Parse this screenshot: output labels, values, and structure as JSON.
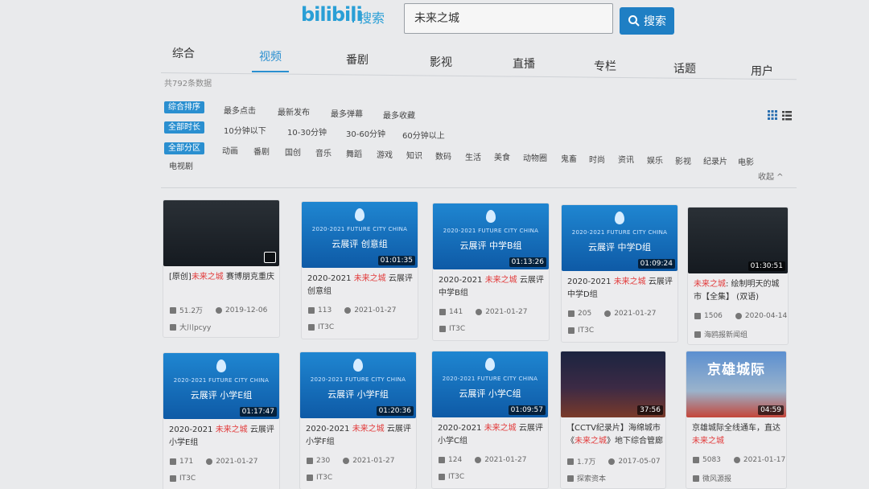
{
  "header": {
    "logo": "bilibili",
    "logo_sub": "搜索",
    "search_value": "未来之城",
    "search_button": "搜索"
  },
  "tabs": [
    "综合",
    "视频",
    "番剧",
    "影视",
    "直播",
    "专栏",
    "话题",
    "用户"
  ],
  "result_count": "共792条数据",
  "filters": {
    "sort": {
      "chip": "综合排序",
      "options": [
        "最多点击",
        "最新发布",
        "最多弹幕",
        "最多收藏"
      ]
    },
    "duration": {
      "chip": "全部时长",
      "options": [
        "10分钟以下",
        "10-30分钟",
        "30-60分钟",
        "60分钟以上"
      ]
    },
    "zone": {
      "chip": "全部分区",
      "options": [
        "动画",
        "番剧",
        "国创",
        "音乐",
        "舞蹈",
        "游戏",
        "知识",
        "数码",
        "生活",
        "美食",
        "动物圈",
        "鬼畜",
        "时尚",
        "资讯",
        "娱乐",
        "影视",
        "纪录片",
        "电影",
        "电视剧"
      ]
    },
    "collapse": "收起 ^"
  },
  "videos": [
    {
      "thumb_dur": "",
      "brand": "",
      "sub": "",
      "title_pre": "[原创]",
      "title_hl": "未来之城",
      "title_post": " 赛博朋克重庆",
      "views": "51.2万",
      "date": "2019-12-06",
      "uploader": "大川pcyy"
    },
    {
      "thumb_dur": "01:01:35",
      "brand": "2020-2021 FUTURE CITY CHINA",
      "sub": "云展评  创意组",
      "title_pre": "2020-2021 ",
      "title_hl": "未来之城",
      "title_post": " 云展评 创意组",
      "views": "113",
      "date": "2021-01-27",
      "uploader": "IT3C"
    },
    {
      "thumb_dur": "01:13:26",
      "brand": "2020-2021 FUTURE CITY CHINA",
      "sub": "云展评  中学B组",
      "title_pre": "2020-2021 ",
      "title_hl": "未来之城",
      "title_post": " 云展评 中学B组",
      "views": "141",
      "date": "2021-01-27",
      "uploader": "IT3C"
    },
    {
      "thumb_dur": "01:09:24",
      "brand": "2020-2021 FUTURE CITY CHINA",
      "sub": "云展评  中学D组",
      "title_pre": "2020-2021 ",
      "title_hl": "未来之城",
      "title_post": " 云展评 中学D组",
      "views": "205",
      "date": "2021-01-27",
      "uploader": "IT3C"
    },
    {
      "thumb_dur": "01:30:51",
      "brand": "",
      "sub": "",
      "title_pre": "",
      "title_hl": "未来之城",
      "title_post": ": 绘制明天的城市【全集】 (双语)",
      "views": "1506",
      "date": "2020-04-14",
      "uploader": "海鸥报新闻组"
    },
    {
      "thumb_dur": "01:17:47",
      "brand": "2020-2021 FUTURE CITY CHINA",
      "sub": "云展评  小学E组",
      "title_pre": "2020-2021 ",
      "title_hl": "未来之城",
      "title_post": " 云展评 小学E组",
      "views": "171",
      "date": "2021-01-27",
      "uploader": "IT3C"
    },
    {
      "thumb_dur": "01:20:36",
      "brand": "2020-2021 FUTURE CITY CHINA",
      "sub": "云展评  小学F组",
      "title_pre": "2020-2021 ",
      "title_hl": "未来之城",
      "title_post": " 云展评 小学F组",
      "views": "230",
      "date": "2021-01-27",
      "uploader": "IT3C"
    },
    {
      "thumb_dur": "01:09:57",
      "brand": "2020-2021 FUTURE CITY CHINA",
      "sub": "云展评  小学C组",
      "title_pre": "2020-2021 ",
      "title_hl": "未来之城",
      "title_post": " 云展评 小学C组",
      "views": "124",
      "date": "2021-01-27",
      "uploader": "IT3C"
    },
    {
      "thumb_dur": "37:56",
      "brand": "",
      "sub": "",
      "title_pre": "【CCTV纪录片】海绵城市《",
      "title_hl": "未来之城",
      "title_post": "》地下综合管廊",
      "views": "1.7万",
      "date": "2017-05-07",
      "uploader": "探索资本"
    },
    {
      "thumb_dur": "04:59",
      "brand": "",
      "sub": "京雄城际",
      "title_pre": "京雄城际全线通车，直达",
      "title_hl": "未来之城",
      "title_post": "",
      "views": "5083",
      "date": "2021-01-17",
      "uploader": "微风源报"
    }
  ]
}
